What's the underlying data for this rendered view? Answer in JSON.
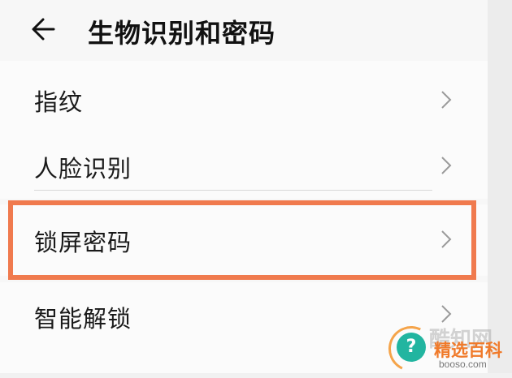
{
  "header": {
    "title": "生物识别和密码",
    "back_icon": "arrow-left-icon"
  },
  "menu": {
    "items": [
      {
        "label": "指纹",
        "icon": "chevron-right-icon"
      },
      {
        "label": "人脸识别",
        "icon": "chevron-right-icon"
      },
      {
        "label": "锁屏密码",
        "icon": "chevron-right-icon",
        "highlighted": true
      },
      {
        "label": "智能解锁",
        "icon": "chevron-right-icon"
      }
    ]
  },
  "watermark": {
    "faded": "酷知网",
    "title": "精选百科",
    "domain": "booso.com",
    "badge": "?"
  },
  "colors": {
    "highlight": "#f07a4e",
    "badge": "#22b5a0",
    "watermark_title": "#f07a2a"
  }
}
